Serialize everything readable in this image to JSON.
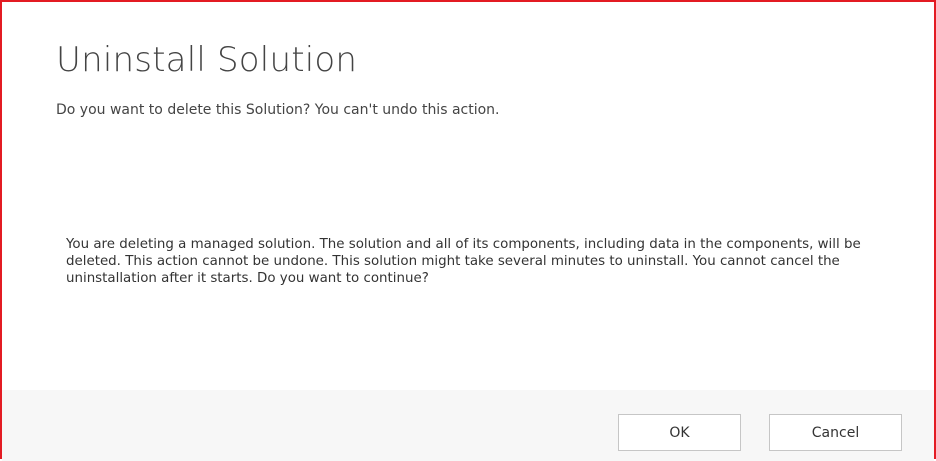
{
  "dialog": {
    "title": "Uninstall Solution",
    "subtitle": "Do you want to delete this Solution? You can't undo this action.",
    "message": "You are deleting a managed solution. The solution and all of its components, including data in the components, will be deleted. This action cannot be undone. This solution might take several minutes to uninstall. You cannot cancel the uninstallation after it starts. Do you want to continue?",
    "ok_label": "OK",
    "cancel_label": "Cancel"
  },
  "colors": {
    "border": "#e31b23",
    "footer_bg": "#f7f7f7",
    "text": "#444444"
  }
}
